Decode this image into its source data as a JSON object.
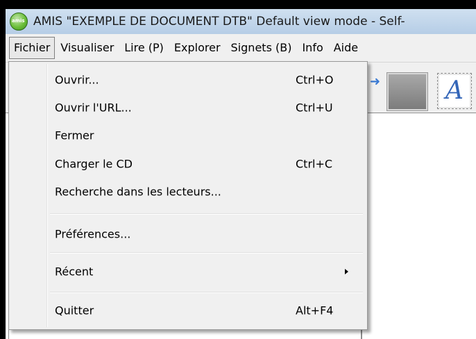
{
  "window": {
    "title": "AMIS \"EXEMPLE DE DOCUMENT DTB\" Default view mode - Self-"
  },
  "menubar": {
    "items": [
      {
        "label": "Fichier"
      },
      {
        "label": "Visualiser"
      },
      {
        "label": "Lire (P)"
      },
      {
        "label": "Explorer"
      },
      {
        "label": "Signets (B)"
      },
      {
        "label": "Info"
      },
      {
        "label": "Aide"
      }
    ]
  },
  "toolbar": {
    "font_glyph": "A"
  },
  "file_menu": {
    "items": [
      {
        "label": "Ouvrir...",
        "shortcut": "Ctrl+O"
      },
      {
        "label": "Ouvrir l'URL...",
        "shortcut": "Ctrl+U"
      },
      {
        "label": "Fermer",
        "shortcut": ""
      },
      {
        "label": "Charger le CD",
        "shortcut": "Ctrl+C"
      },
      {
        "label": "Recherche dans les lecteurs...",
        "shortcut": ""
      },
      {
        "label": "Préférences...",
        "shortcut": ""
      },
      {
        "label": "Récent",
        "shortcut": "",
        "submenu": true
      },
      {
        "label": "Quitter",
        "shortcut": "Alt+F4"
      }
    ]
  },
  "colors": {
    "title_bar": "#c4d8ec",
    "menu_bg": "#f0f0f0",
    "accent_blue": "#3466b8"
  }
}
